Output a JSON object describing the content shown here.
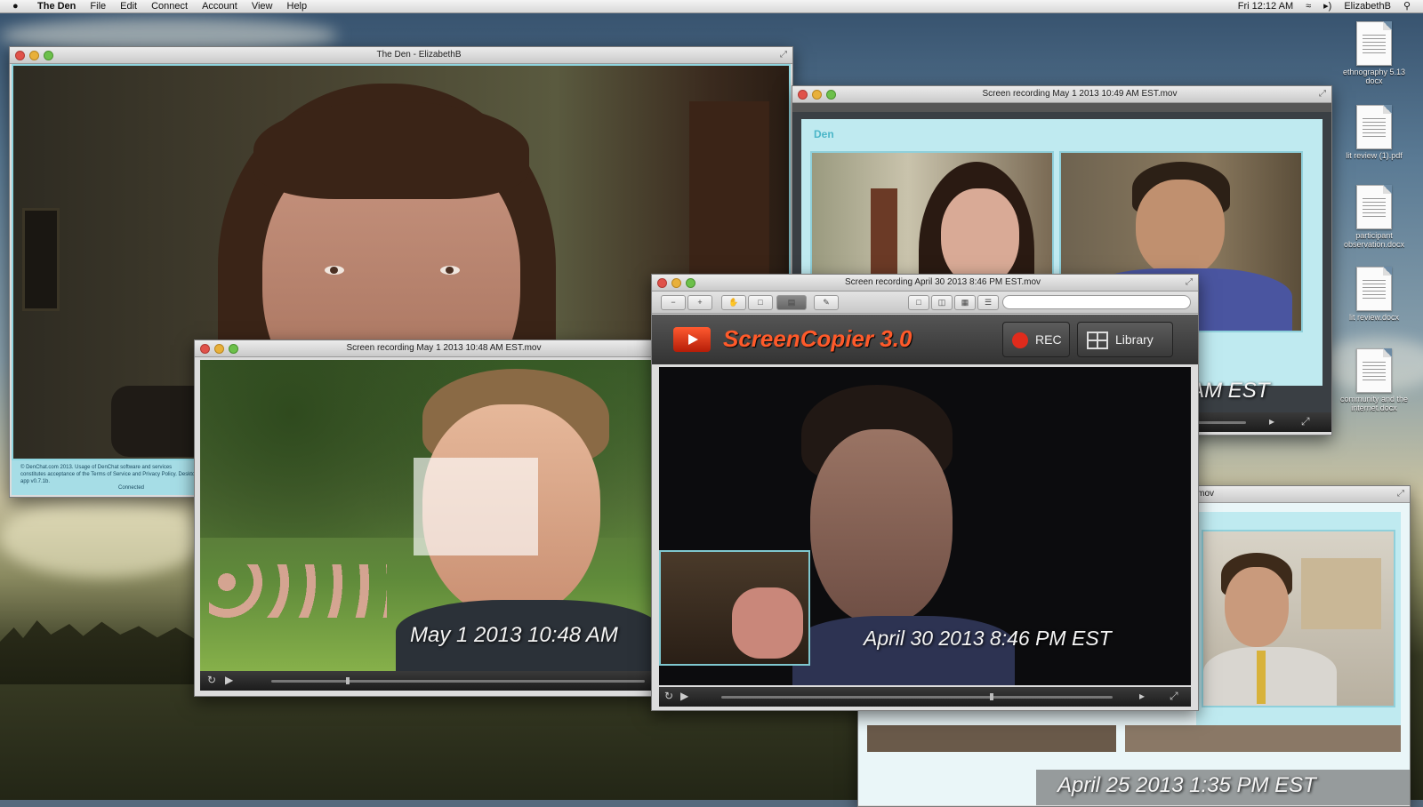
{
  "menubar": {
    "apple_icon": "apple-logo",
    "app_name": "The Den",
    "menus": [
      "File",
      "Edit",
      "Connect",
      "Account",
      "View",
      "Help"
    ],
    "clock": "Fri 12:12 AM",
    "user": "ElizabethB"
  },
  "desktop_icons": [
    {
      "label": "ethnography 5.13 docx"
    },
    {
      "label": "lit review (1).pdf"
    },
    {
      "label": "participant observation.docx"
    },
    {
      "label": "lit review.docx"
    },
    {
      "label": "community and the internet.docx"
    }
  ],
  "den_window": {
    "title": "The Den - ElizabethB",
    "footer_text": "© DenChat.com 2013. Usage of DenChat software and services constitutes acceptance of the Terms of Service and Privacy Policy. Desktop app v0.7.1b.",
    "footer_link": "Connected"
  },
  "rec_may1_1049": {
    "title": "Screen recording May 1 2013 10:49 AM EST.mov",
    "app_logo": "Den",
    "timestamp": "9 AM EST"
  },
  "rec_may1_1048": {
    "title": "Screen recording May 1 2013 10:48 AM EST.mov",
    "timestamp": "May 1  2013 10:48 AM"
  },
  "screencopier": {
    "title": "Screen recording April 30  2013 8:46 PM EST.mov",
    "app_title": "ScreenCopier 3.0",
    "rec_label": "REC",
    "library_label": "Library",
    "timestamp": "April 30 2013 8:46 PM EST"
  },
  "rec_apr25": {
    "title": "EST.mov",
    "timestamp": "April 25  2013 1:35 PM EST"
  },
  "colors": {
    "accent_cyan": "#8fd6e0",
    "screencopier_orange": "#ff5a2a",
    "rec_red": "#e02b1c"
  }
}
